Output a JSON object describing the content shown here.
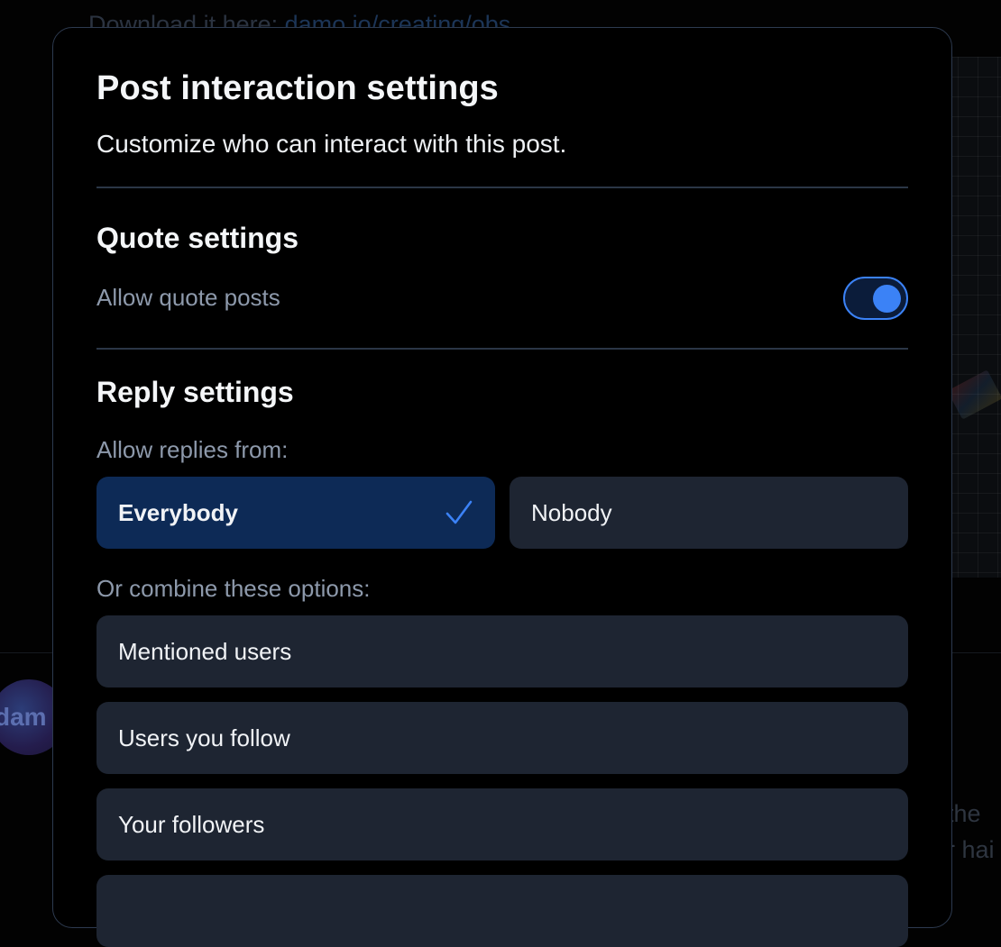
{
  "background": {
    "top_text_prefix": "Download it here:",
    "top_text_link": "damo.io/creating/obs",
    "avatar_label": "dam",
    "side_text_1": "the",
    "side_text_2": "r hai"
  },
  "dialog": {
    "title": "Post interaction settings",
    "subtitle": "Customize who can interact with this post."
  },
  "quote": {
    "heading": "Quote settings",
    "toggle_label": "Allow quote posts",
    "enabled": true
  },
  "reply": {
    "heading": "Reply settings",
    "allow_from_label": "Allow replies from:",
    "everybody_label": "Everybody",
    "nobody_label": "Nobody",
    "selected": "Everybody",
    "combine_label": "Or combine these options:",
    "options": [
      "Mentioned users",
      "Users you follow",
      "Your followers",
      ""
    ]
  },
  "colors": {
    "accent": "#3b82f6",
    "selected_bg": "#0d2a56",
    "option_bg": "#1e2532",
    "dialog_bg": "#000000",
    "border": "#2d3a4f"
  },
  "icons": {
    "selected_check": "check-icon"
  }
}
